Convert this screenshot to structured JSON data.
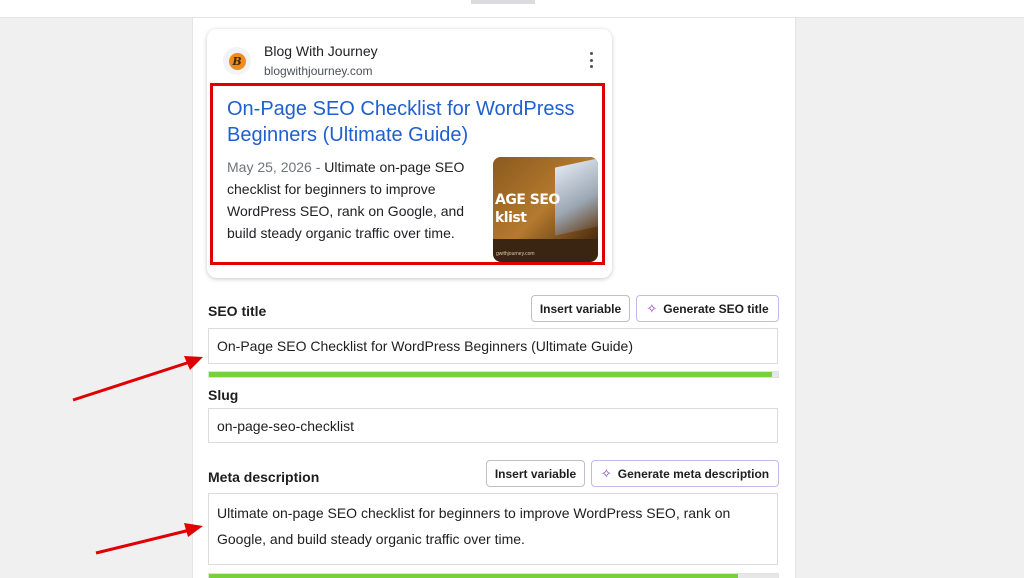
{
  "serp": {
    "site_name": "Blog With Journey",
    "site_url": "blogwithjourney.com",
    "favicon_letter": "B",
    "title": "On-Page SEO Checklist for WordPress Beginners (Ultimate Guide)",
    "date": "May 25, 2026",
    "separator": " - ",
    "description": "Ultimate on-page SEO checklist for beginners to improve WordPress SEO, rank on Google, and build steady organic traffic over time.",
    "thumbnail_text_line1": "AGE SEO",
    "thumbnail_text_line2": "klist",
    "thumbnail_footer": "gwithjourney.com"
  },
  "seo_title": {
    "label": "SEO title",
    "insert_variable": "Insert variable",
    "generate": "Generate SEO title",
    "value": "On-Page SEO Checklist for WordPress Beginners (Ultimate Guide)",
    "progress": 0.99
  },
  "slug": {
    "label": "Slug",
    "value": "on-page-seo-checklist"
  },
  "meta_description": {
    "label": "Meta description",
    "insert_variable": "Insert variable",
    "generate": "Generate meta description",
    "value": "Ultimate on-page SEO checklist for beginners to improve WordPress SEO, rank on Google, and build steady organic traffic over time.",
    "progress": 0.93
  },
  "colors": {
    "accent_link": "#1f5fcf",
    "highlight_box": "#e00000",
    "progress_good": "#7ad03a",
    "ai_sparkle": "#8b3fb8"
  },
  "icons": {
    "sparkle": "sparkle-icon",
    "more": "more-vertical-icon"
  }
}
